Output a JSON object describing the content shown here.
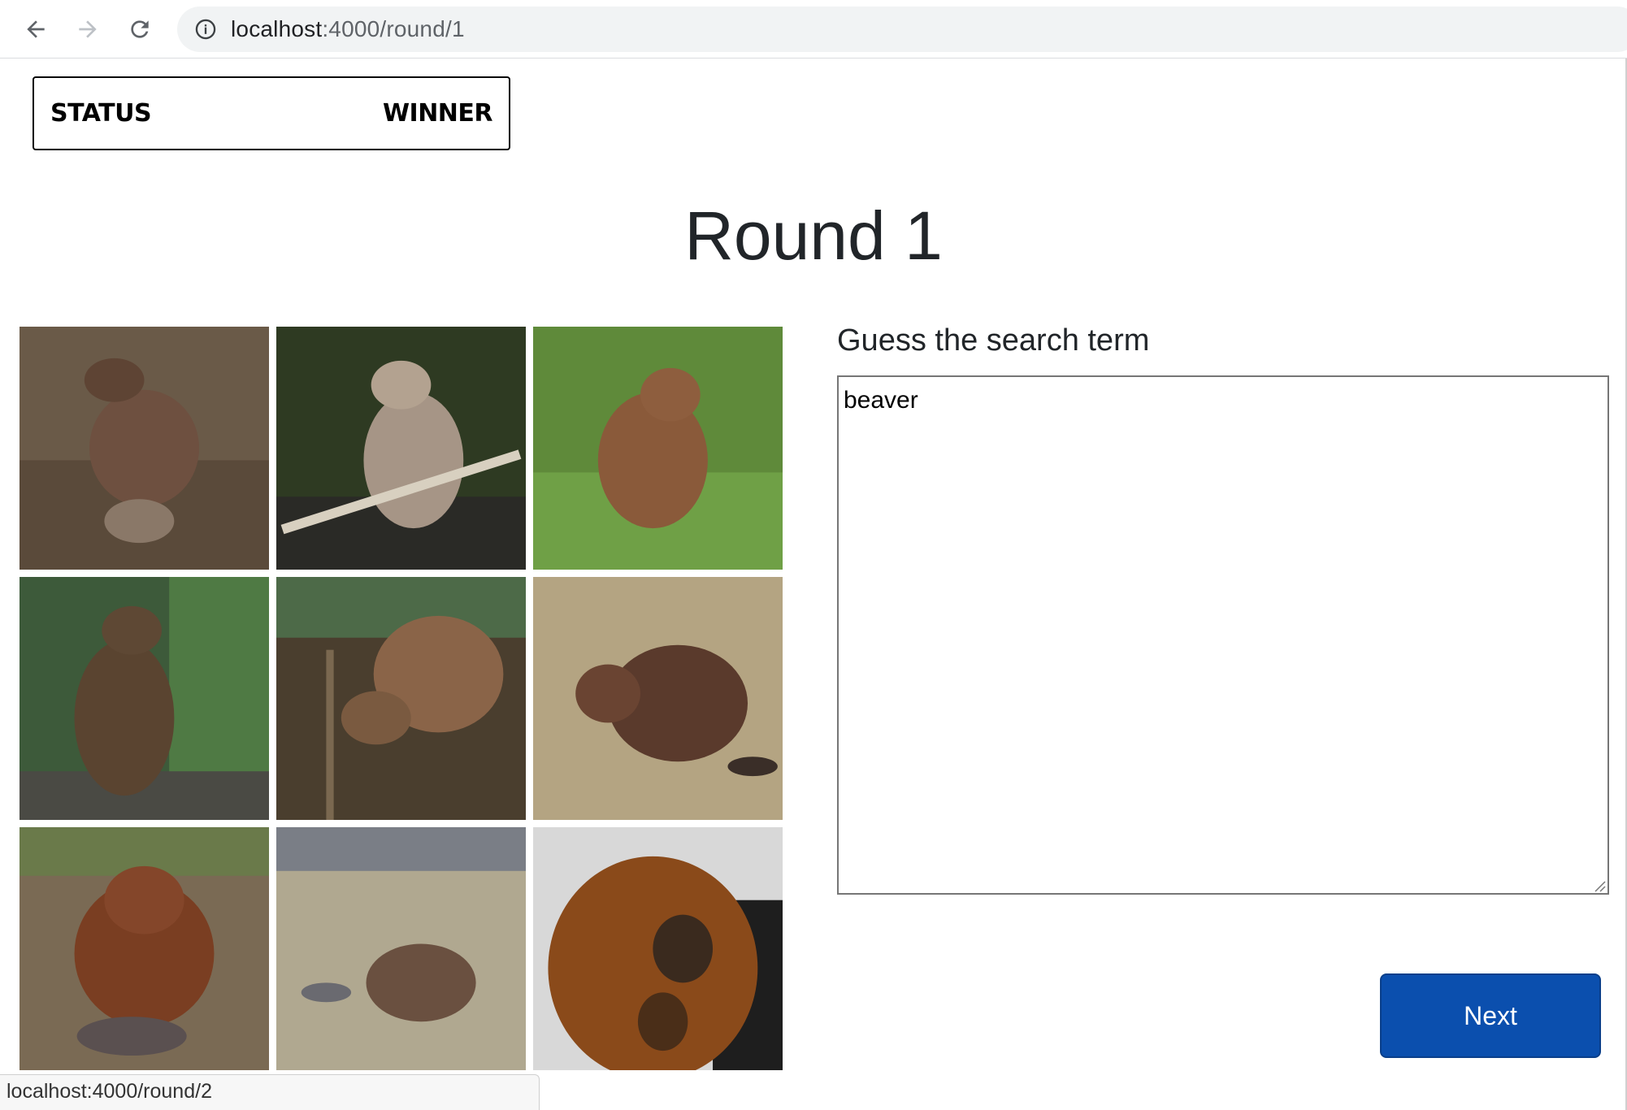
{
  "browser": {
    "url_host": "localhost",
    "url_rest": ":4000/round/1"
  },
  "status_bar": {
    "status_label": "STATUS",
    "winner_label": "WINNER"
  },
  "round": {
    "title": "Round 1"
  },
  "images": [
    {
      "alt": "beaver image 1"
    },
    {
      "alt": "beaver image 2"
    },
    {
      "alt": "beaver image 3"
    },
    {
      "alt": "beaver image 4"
    },
    {
      "alt": "beaver image 5"
    },
    {
      "alt": "beaver image 6"
    },
    {
      "alt": "beaver image 7"
    },
    {
      "alt": "beaver image 8"
    },
    {
      "alt": "beaver image 9"
    }
  ],
  "guess": {
    "label": "Guess the search term",
    "value": "beaver"
  },
  "next_button": {
    "label": "Next"
  },
  "hover_link": {
    "url": "localhost:4000/round/2"
  },
  "colors": {
    "primary": "#0b4fae"
  }
}
